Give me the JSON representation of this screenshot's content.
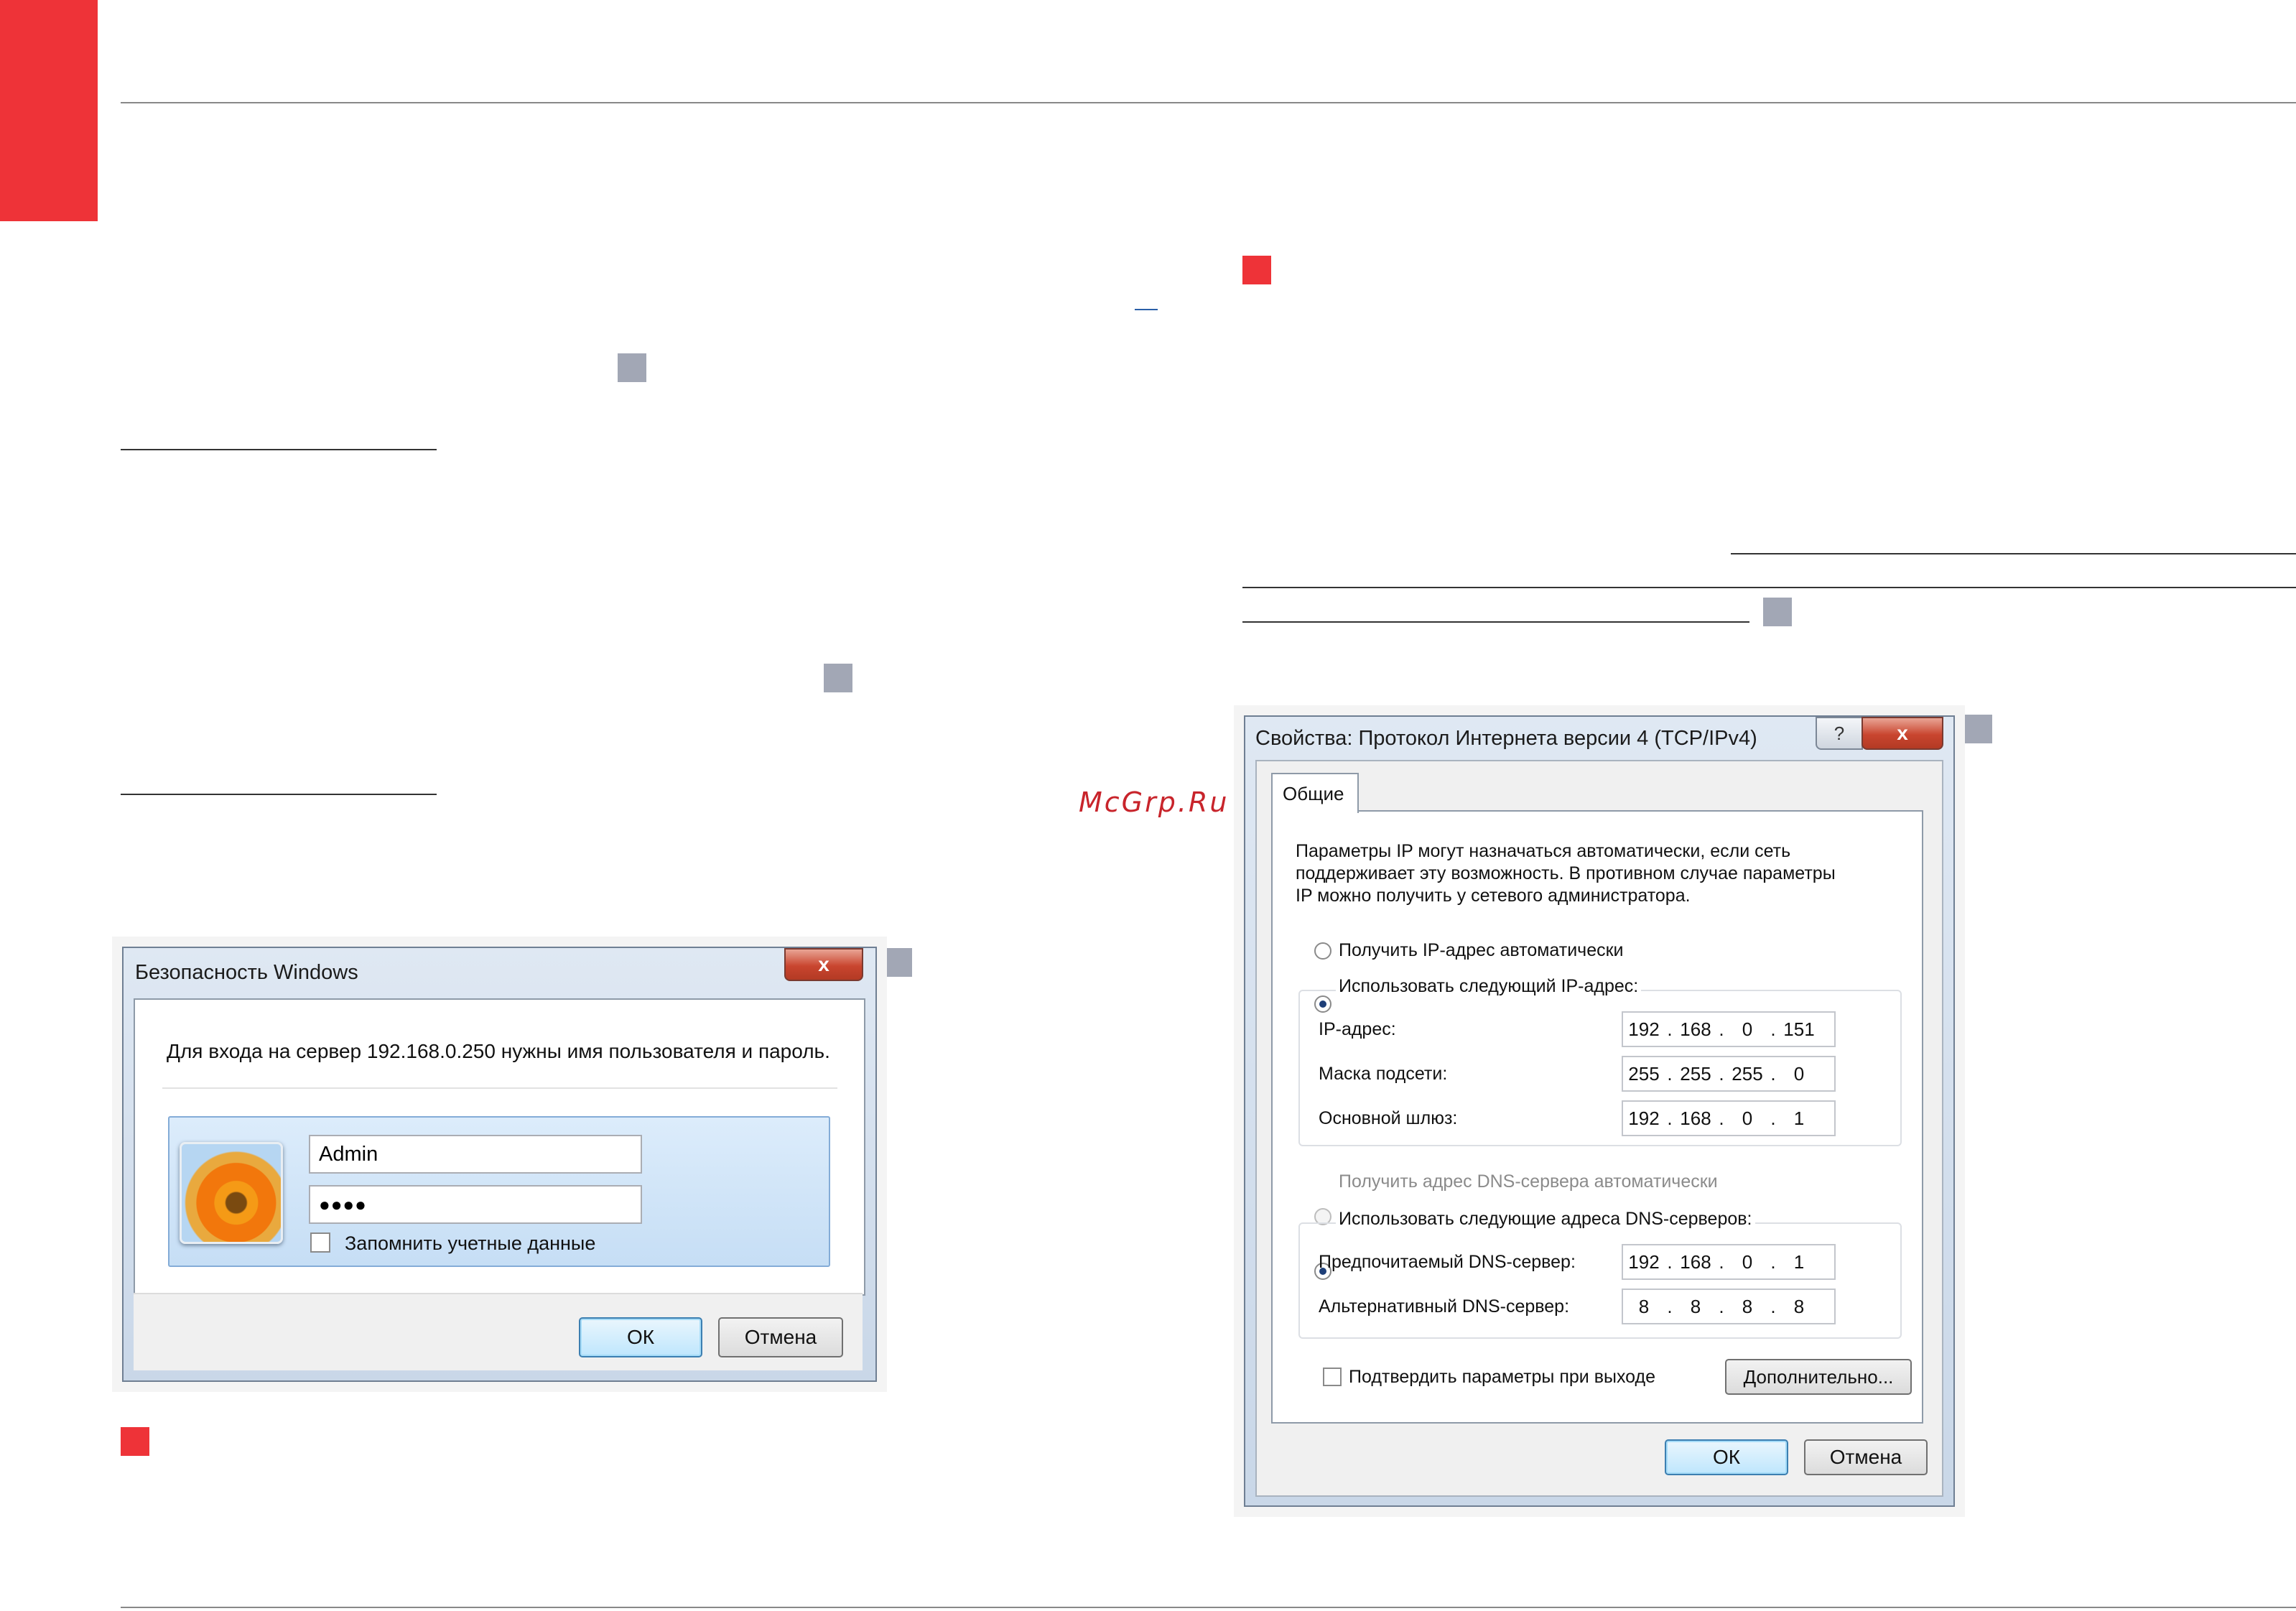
{
  "watermark": "McGrp.Ru",
  "colors": {
    "accent_red": "#ee3338",
    "marker_grey": "#a2a7b5"
  },
  "login_dialog": {
    "title": "Безопасность Windows",
    "close_label": "x",
    "message": "Для входа на сервер 192.168.0.250 нужны имя пользователя и пароль.",
    "username_value": "Admin",
    "password_value": "●●●●",
    "remember_label": "Запомнить учетные данные",
    "avatar_icon": "flower-user-icon",
    "ok_label": "ОК",
    "cancel_label": "Отмена"
  },
  "ipv4_dialog": {
    "title": "Свойства: Протокол Интернета версии 4 (TCP/IPv4)",
    "help_label": "?",
    "close_label": "x",
    "tab_general": "Общие",
    "intro_line1": "Параметры IP могут назначаться автоматически, если сеть",
    "intro_line2": "поддерживает эту возможность. В противном случае параметры",
    "intro_line3": "IP можно получить у сетевого администратора.",
    "radio_auto_ip": "Получить IP-адрес автоматически",
    "radio_manual_ip": "Использовать следующий IP-адрес:",
    "ip_label": "IP-адрес:",
    "ip": [
      "192",
      "168",
      "0",
      "151"
    ],
    "mask_label": "Маска подсети:",
    "mask": [
      "255",
      "255",
      "255",
      "0"
    ],
    "gateway_label": "Основной шлюз:",
    "gateway": [
      "192",
      "168",
      "0",
      "1"
    ],
    "radio_auto_dns": "Получить адрес DNS-сервера автоматически",
    "radio_manual_dns": "Использовать следующие адреса DNS-серверов:",
    "dns1_label": "Предпочитаемый DNS-сервер:",
    "dns1": [
      "192",
      "168",
      "0",
      "1"
    ],
    "dns2_label": "Альтернативный DNS-сервер:",
    "dns2": [
      "8",
      "8",
      "8",
      "8"
    ],
    "validate_label": "Подтвердить параметры при выходе",
    "advanced_label": "Дополнительно...",
    "ok_label": "ОК",
    "cancel_label": "Отмена"
  }
}
